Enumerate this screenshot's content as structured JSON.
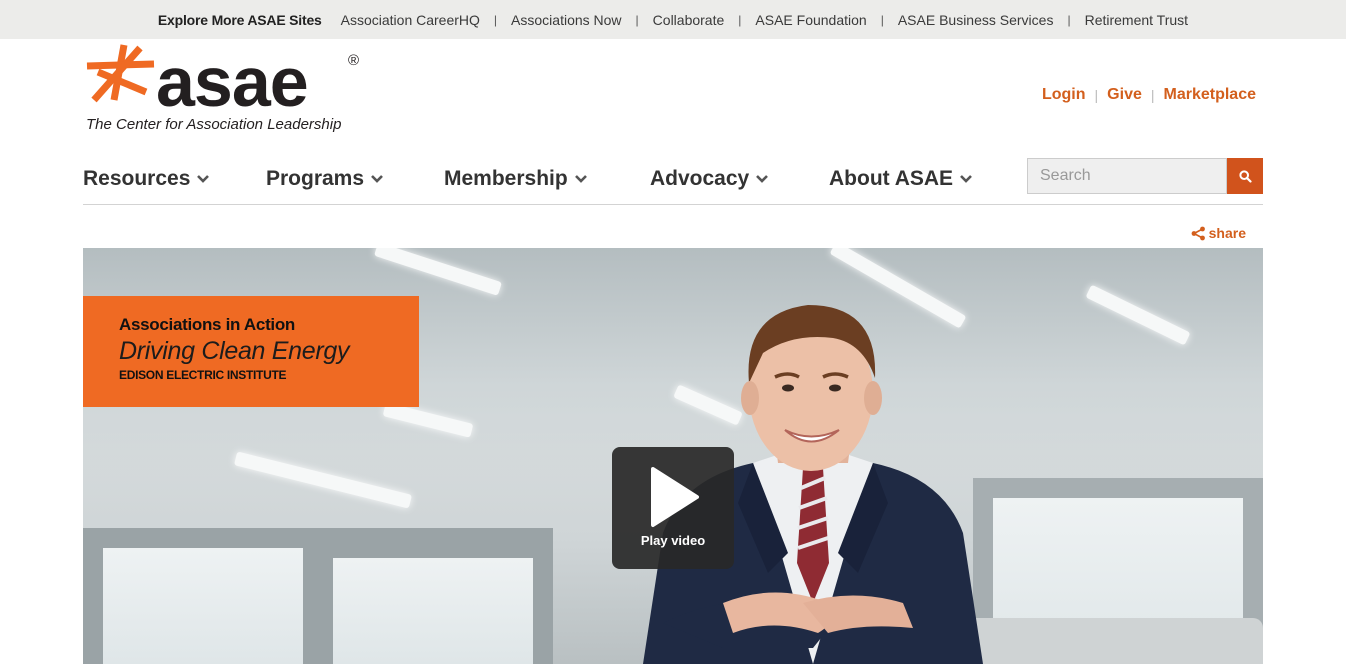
{
  "topbar": {
    "explore_label": "Explore More ASAE Sites",
    "sites": [
      "Association CareerHQ",
      "Associations Now",
      "Collaborate",
      "ASAE Foundation",
      "ASAE Business Services",
      "Retirement Trust"
    ],
    "separator": "|"
  },
  "logo": {
    "wordmark": "asae",
    "registered": "®",
    "tagline": "The Center for Association Leadership",
    "star_color": "#ef6a23"
  },
  "account": {
    "login": "Login",
    "give": "Give",
    "marketplace": "Marketplace",
    "separator": "|"
  },
  "nav": {
    "items": [
      "Resources",
      "Programs",
      "Membership",
      "Advocacy",
      "About ASAE"
    ]
  },
  "search": {
    "placeholder": "Search",
    "button_icon": "search-icon"
  },
  "share": {
    "label": "share",
    "icon": "share-icon"
  },
  "hero": {
    "kicker": "Associations in Action",
    "headline": "Driving Clean Energy",
    "organization": "EDISON ELECTRIC INSTITUTE",
    "play_label": "Play video",
    "caption_color": "#ef6a23"
  },
  "colors": {
    "accent": "#d35f1d",
    "search_button": "#d1531c",
    "topbar_bg": "#ececea"
  }
}
